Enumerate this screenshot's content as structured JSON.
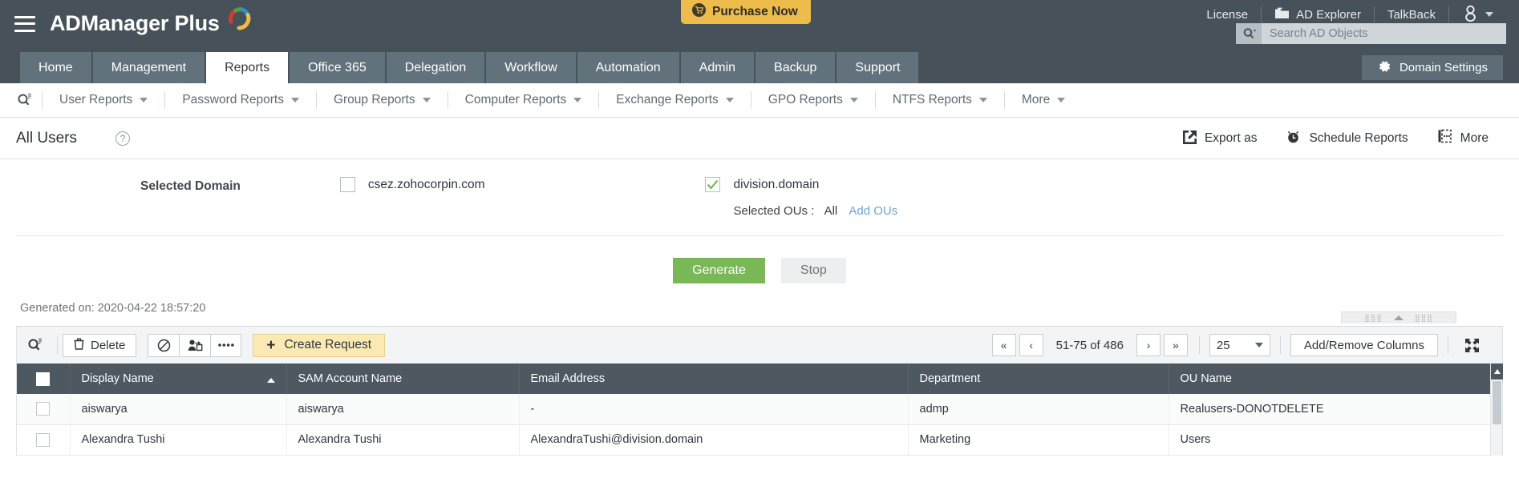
{
  "app": {
    "brand": "ADManager Plus",
    "purchase_label": "Purchase Now"
  },
  "topbar": {
    "license": "License",
    "ad_explorer": "AD Explorer",
    "talkback": "TalkBack",
    "search_placeholder": "Search AD Objects"
  },
  "mainnav": {
    "tabs": [
      {
        "label": "Home",
        "active": false
      },
      {
        "label": "Management",
        "active": false
      },
      {
        "label": "Reports",
        "active": true
      },
      {
        "label": "Office 365",
        "active": false
      },
      {
        "label": "Delegation",
        "active": false
      },
      {
        "label": "Workflow",
        "active": false
      },
      {
        "label": "Automation",
        "active": false
      },
      {
        "label": "Admin",
        "active": false
      },
      {
        "label": "Backup",
        "active": false
      },
      {
        "label": "Support",
        "active": false
      }
    ],
    "domain_settings": "Domain Settings"
  },
  "subnav": {
    "items": [
      "User Reports",
      "Password Reports",
      "Group Reports",
      "Computer Reports",
      "Exchange Reports",
      "GPO Reports",
      "NTFS Reports",
      "More"
    ]
  },
  "page": {
    "title": "All Users",
    "actions": [
      {
        "label": "Export as",
        "icon": "export-icon"
      },
      {
        "label": "Schedule Reports",
        "icon": "alarm-clock-icon"
      },
      {
        "label": "More",
        "icon": "more-panel-icon"
      }
    ]
  },
  "domain_panel": {
    "label": "Selected Domain",
    "domains": [
      {
        "name": "csez.zohocorpin.com",
        "checked": false
      },
      {
        "name": "division.domain",
        "checked": true
      }
    ],
    "ou_label": "Selected OUs :",
    "ou_value": "All",
    "add_ous_link": "Add OUs",
    "generate_label": "Generate",
    "stop_label": "Stop",
    "generated_on": "Generated on: 2020-04-22 18:57:20"
  },
  "table_toolbar": {
    "delete_label": "Delete",
    "create_request_label": "Create Request",
    "pagination_text": "51-75 of 486",
    "page_size": "25",
    "add_remove_columns": "Add/Remove Columns"
  },
  "table": {
    "columns": [
      "Display Name",
      "SAM Account Name",
      "Email Address",
      "Department",
      "OU Name"
    ],
    "sorted_column": "Display Name",
    "rows": [
      {
        "display_name": "aiswarya",
        "sam_account_name": "aiswarya",
        "email": "-",
        "department": "admp",
        "ou_name": "Realusers-DONOTDELETE"
      },
      {
        "display_name": "Alexandra Tushi",
        "sam_account_name": "Alexandra Tushi",
        "email": "AlexandraTushi@division.domain",
        "department": "Marketing",
        "ou_name": "Users"
      }
    ]
  },
  "colors": {
    "header_bg": "#475159",
    "tab_bg": "#62727c",
    "accent_yellow": "#edbc4a",
    "generate_green": "#79b757",
    "table_header": "#4e5861",
    "link_blue": "#6aa7d8"
  }
}
